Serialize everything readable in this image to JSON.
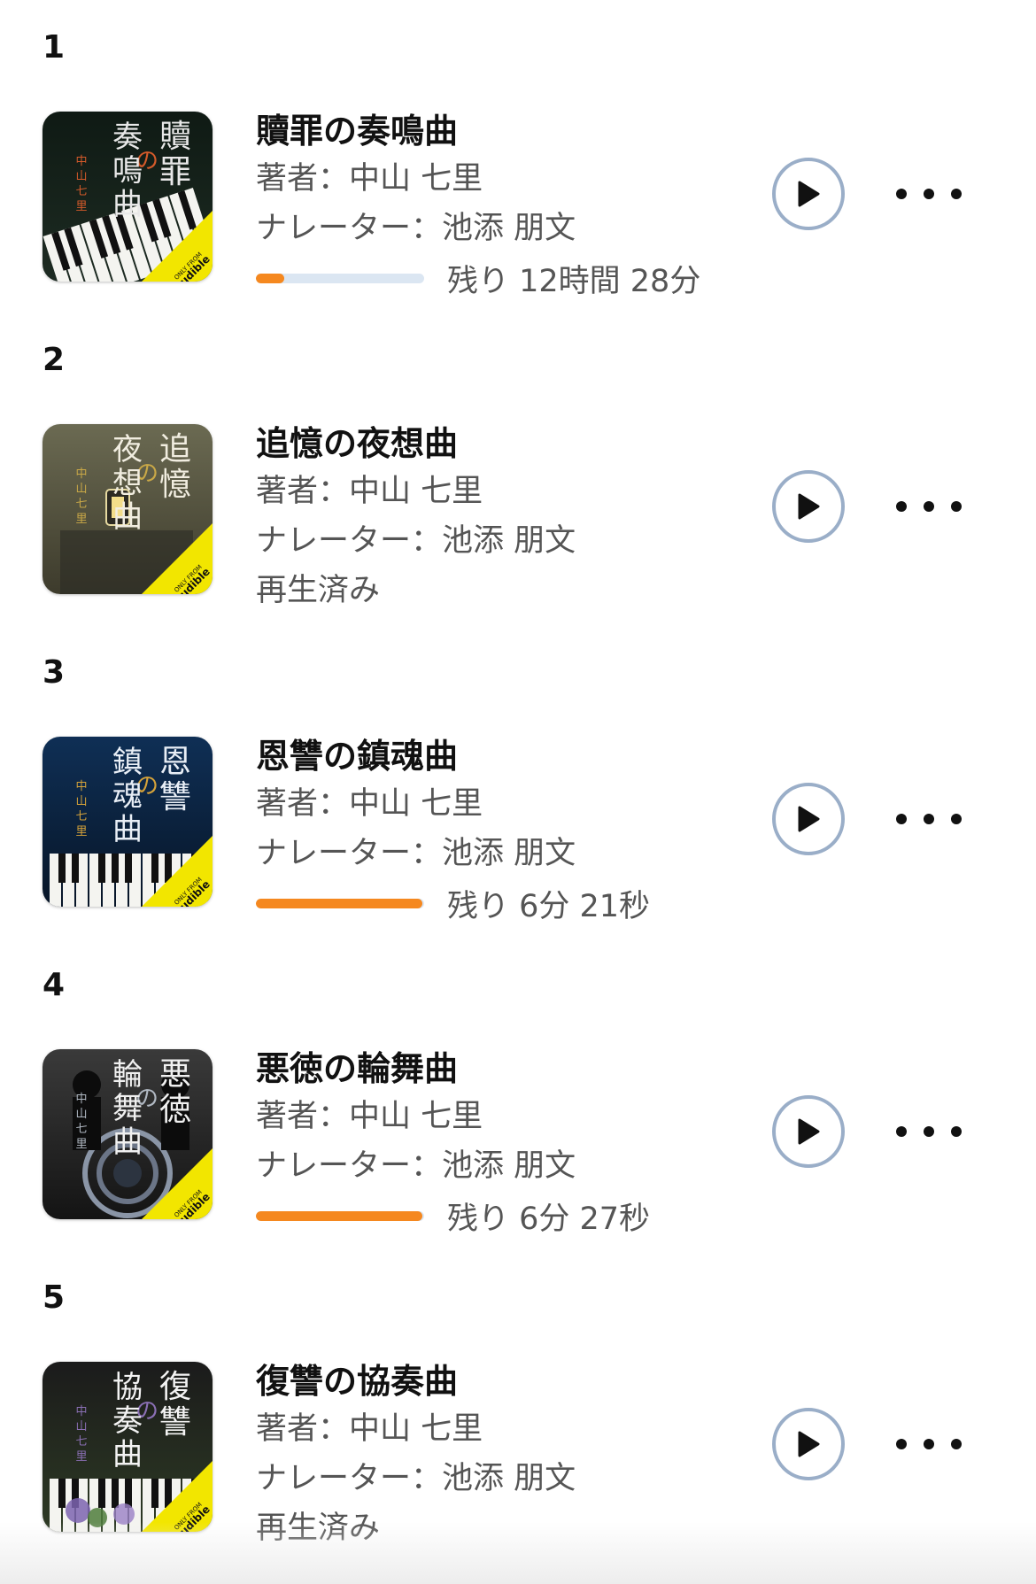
{
  "accent_color": "#f5881f",
  "track_color": "#dbe6f2",
  "play_ring_color": "#9aaec8",
  "items": [
    {
      "rank": "1",
      "title": "贖罪の奏鳴曲",
      "author_label": "著者：",
      "author": "中山 七里",
      "narrator_label": "ナレーター：",
      "narrator": "池添 朋文",
      "status": "progress",
      "progress": 0.17,
      "remaining": "残り 12時間 28分",
      "cover": {
        "title_chars": "贖罪の奏鳴曲",
        "author": "中山七里",
        "badge_top": "ONLY FROM",
        "badge": "audible",
        "icon": "piano-cover-art"
      }
    },
    {
      "rank": "2",
      "title": "追憶の夜想曲",
      "author_label": "著者：",
      "author": "中山 七里",
      "narrator_label": "ナレーター：",
      "narrator": "池添 朋文",
      "status": "finished",
      "finished_label": "再生済み",
      "cover": {
        "title_chars": "追憶の夜想曲",
        "author": "中山七里",
        "badge_top": "ONLY FROM",
        "badge": "audible",
        "icon": "lantern-cover-art"
      }
    },
    {
      "rank": "3",
      "title": "恩讐の鎮魂曲",
      "author_label": "著者：",
      "author": "中山 七里",
      "narrator_label": "ナレーター：",
      "narrator": "池添 朋文",
      "status": "progress",
      "progress": 0.99,
      "remaining": "残り 6分 21秒",
      "cover": {
        "title_chars": "恩讐の鎮魂曲",
        "author": "中山七里",
        "badge_top": "ONLY FROM",
        "badge": "audible",
        "icon": "piano-keys-cover-art"
      }
    },
    {
      "rank": "4",
      "title": "悪徳の輪舞曲",
      "author_label": "著者：",
      "author": "中山 七里",
      "narrator_label": "ナレーター：",
      "narrator": "池添 朋文",
      "status": "progress",
      "progress": 0.99,
      "remaining": "残り 6分 27秒",
      "cover": {
        "title_chars": "悪徳の輪舞曲",
        "author": "中山七里",
        "badge_top": "ONLY FROM",
        "badge": "audible",
        "icon": "silhouette-cover-art"
      }
    },
    {
      "rank": "5",
      "title": "復讐の協奏曲",
      "author_label": "著者：",
      "author": "中山 七里",
      "narrator_label": "ナレーター：",
      "narrator": "池添 朋文",
      "status": "finished",
      "finished_label": "再生済み",
      "cover": {
        "title_chars": "復讐の協奏曲",
        "author": "中山七里",
        "badge_top": "ONLY FROM",
        "badge": "audible",
        "icon": "flowers-piano-cover-art"
      }
    }
  ]
}
